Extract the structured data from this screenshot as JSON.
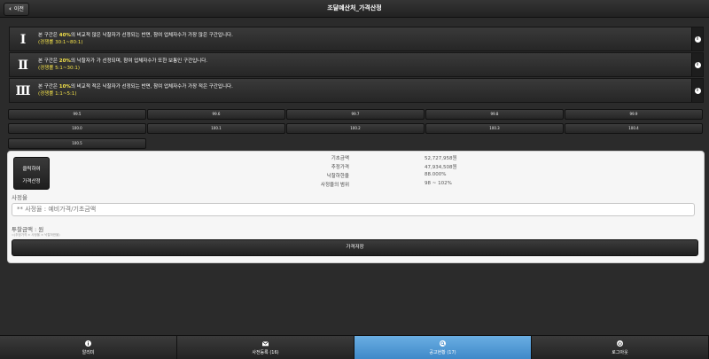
{
  "header": {
    "back_label": "이전",
    "title": "조달예산처_가격산정"
  },
  "notices": [
    {
      "roman": "Ⅰ",
      "pre": "본 구간은 ",
      "pct": "40%",
      "post": "의 비교적 많은 낙찰자가 선정되는 반면, 참여 업체자수가 가장 많은 구간입니다.",
      "sub": "(경쟁률 30:1~80:1)"
    },
    {
      "roman": "Ⅱ",
      "pre": "본 구간은 ",
      "pct": "20%",
      "post": "의 낙찰자가 가 선정되며, 참여 업체자수가 또한 보통인 구간입니다.",
      "sub": "(경쟁률 5:1~30:1)"
    },
    {
      "roman": "Ⅲ",
      "pre": "본 구간은 ",
      "pct": "10%",
      "post": "의 비교적 적은 낙찰자가 선정되는 반면, 참여 업체자수가 가장 적은 구간입니다.",
      "sub": "(경쟁률 1:1~5:1)"
    }
  ],
  "rates": [
    "99.5",
    "99.6",
    "99.7",
    "99.8",
    "99.9",
    "100.0",
    "100.1",
    "100.2",
    "100.3",
    "100.4",
    "100.5"
  ],
  "panel": {
    "calc_line1": "클릭하여",
    "calc_line2": "가격산정",
    "info": [
      {
        "k": "기초금액",
        "v": "52,727,958원"
      },
      {
        "k": "추정가격",
        "v": "47,934,508원"
      },
      {
        "k": "낙찰하한율",
        "v": "88.000%"
      },
      {
        "k": "사정율의 범위",
        "v": "98 ~ 102%"
      }
    ],
    "rate_label": "사정율",
    "rate_placeholder": "** 사정율 : 예비가격/기초금액",
    "bid_label": "투찰금액 : 원",
    "formula": "=(추정가격 × 사정율 × 낙찰하한율)",
    "save_label": "가격저장"
  },
  "tabs": [
    {
      "label": "알리미",
      "icon": "info-icon",
      "active": false
    },
    {
      "label": "사전등록 (16)",
      "icon": "mail-icon",
      "active": false
    },
    {
      "label": "공고현황 (17)",
      "icon": "search-icon",
      "active": true
    },
    {
      "label": "로그아웃",
      "icon": "power-icon",
      "active": false
    }
  ],
  "colors": {
    "accent": "#f5e34a",
    "active_tab": "#4f97d3"
  }
}
